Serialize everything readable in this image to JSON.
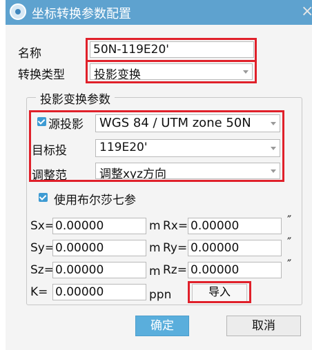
{
  "window": {
    "title": "坐标转换参数配置",
    "close_glyph": "×"
  },
  "form": {
    "name_label": "名称",
    "name_value": "50N-119E20'",
    "conv_type_label": "转换类型",
    "conv_type_value": "投影变换"
  },
  "projection_group": {
    "title": "投影变换参数",
    "source_label": "源投影",
    "source_value": "WGS 84 / UTM zone 50N",
    "source_checked": true,
    "target_label": "目标投",
    "target_value": "119E20'",
    "adjust_label": "调整范",
    "adjust_value": "调整xyz方向"
  },
  "bursa": {
    "label": "使用布尔莎七参",
    "checked": true
  },
  "params": {
    "sx_label": "Sx=",
    "sx_value": "0.00000",
    "sx_unit": "m",
    "rx_label": "Rx=",
    "rx_value": "0.00000",
    "rx_unit": "″",
    "sy_label": "Sy=",
    "sy_value": "0.00000",
    "sy_unit": "m",
    "ry_label": "Ry=",
    "ry_value": "0.00000",
    "ry_unit": "″",
    "sz_label": "Sz=",
    "sz_value": "0.00000",
    "sz_unit": "m",
    "rz_label": "Rz=",
    "rz_value": "0.00000",
    "rz_unit": "″",
    "k_label": "K=",
    "k_value": "0.00000",
    "k_unit": "ppn"
  },
  "buttons": {
    "import": "导入",
    "ok": "确定",
    "cancel": "取消"
  },
  "colors": {
    "titlebar": "#5ea2cf",
    "highlight_box": "#e0202a",
    "ok_button": "#5aaedc",
    "checkbox": "#3e9bd3"
  },
  "icons": {
    "app": "globe-icon",
    "close": "close-icon",
    "dropdown": "chevron-down-icon",
    "check": "checkbox-checked-icon"
  }
}
